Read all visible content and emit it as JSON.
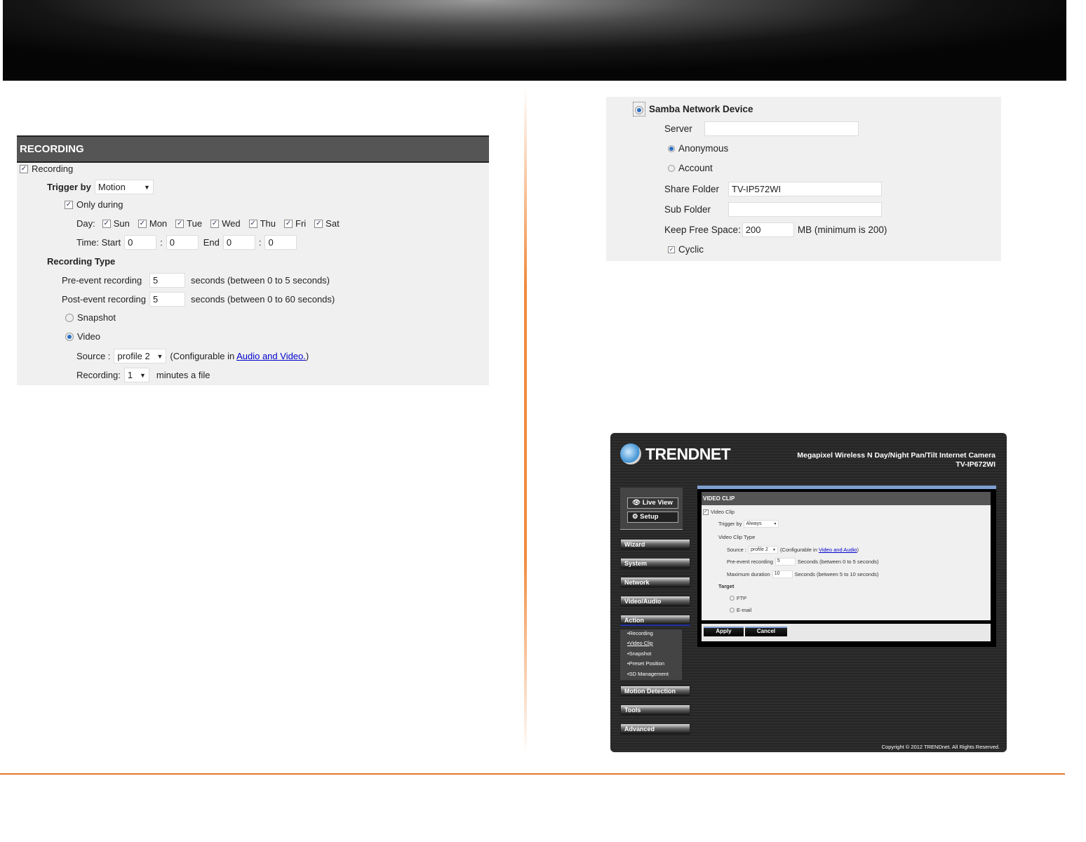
{
  "recording": {
    "title": "RECORDING",
    "recording_label": "Recording",
    "trigger_label": "Trigger by",
    "trigger_value": "Motion",
    "only_during": "Only during",
    "day_label": "Day:",
    "days": [
      "Sun",
      "Mon",
      "Tue",
      "Wed",
      "Thu",
      "Fri",
      "Sat"
    ],
    "time_start": "Time: Start",
    "start_h": "0",
    "start_m": "0",
    "end_label": "End",
    "end_h": "0",
    "end_m": "0",
    "colon": ":",
    "type_label": "Recording Type",
    "pre_label": "Pre-event recording",
    "pre_value": "5",
    "pre_hint": "seconds  (between 0 to 5 seconds)",
    "post_label": "Post-event recording",
    "post_value": "5",
    "post_hint": "seconds  (between 0 to 60 seconds)",
    "snapshot": "Snapshot",
    "video": "Video",
    "source_label": "Source :",
    "source_value": "profile 2",
    "config_pre": "(Configurable in ",
    "config_link": "Audio and Video.",
    "config_post": ")",
    "rec_label": "Recording:",
    "rec_value": "1",
    "rec_unit": "minutes a file"
  },
  "samba": {
    "title": "Samba Network Device",
    "server_label": "Server",
    "server_value": "",
    "anonymous": "Anonymous",
    "account": "Account",
    "share_label": "Share Folder",
    "share_value": "TV-IP572WI",
    "sub_label": "Sub Folder",
    "sub_value": "",
    "keep_label": "Keep Free Space:",
    "keep_value": "200",
    "keep_unit": "MB (minimum is 200)",
    "cyclic": "Cyclic"
  },
  "camera": {
    "logo": "TRENDNET",
    "product": "Megapixel Wireless N Day/Night Pan/Tilt Internet Camera",
    "model": "TV-IP672WI",
    "live_view": "Live View",
    "setup": "Setup",
    "nav": [
      "Wizard",
      "System",
      "Network",
      "Video/Audio",
      "Action"
    ],
    "sub_nav": [
      "•Recording",
      "•Video Clip",
      "•Snapshot",
      "•Preset Position",
      "•SD Management"
    ],
    "nav2": [
      "Motion Detection",
      "Tools",
      "Advanced"
    ],
    "panel_title": "VIDEO CLIP",
    "video_clip": "Video Clip",
    "trigger_label": "Trigger by",
    "trigger_value": "Always",
    "type_label": "Video Clip Type",
    "source_label": "Source :",
    "source_value": "profile 2",
    "config_pre": "(Configurable in ",
    "config_link": "Video and Audio",
    "config_post": ")",
    "pre_label": "Pre-event recording",
    "pre_value": "5",
    "pre_hint": "Seconds  (between 0 to 5 seconds)",
    "max_label": "Maximum duration",
    "max_value": "10",
    "max_hint": "Seconds  (between 5 to 10 seconds)",
    "target": "Target",
    "ftp": "FTP",
    "email": "E-mail",
    "apply": "Apply",
    "cancel": "Cancel",
    "copyright": "Copyright © 2012 TRENDnet. All Rights Reserved."
  }
}
